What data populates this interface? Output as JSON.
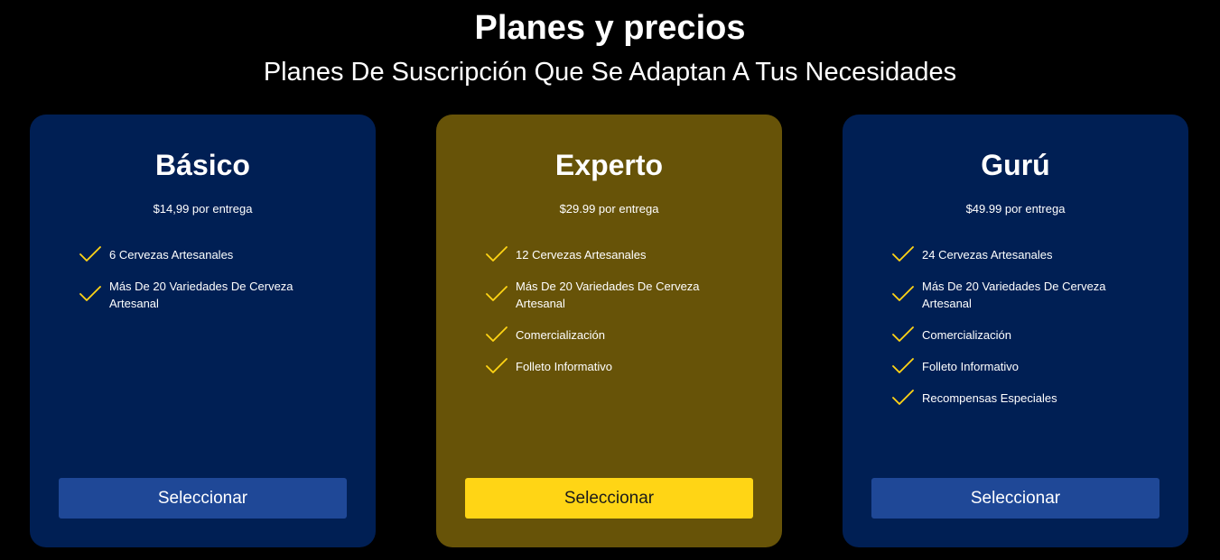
{
  "header": {
    "title": "Planes y precios",
    "subtitle": "Planes De Suscripción Que Se Adaptan A Tus Necesidades"
  },
  "colors": {
    "background": "#000000",
    "card_default": "#001f54",
    "card_featured": "#675308",
    "button_default": "#1f4897",
    "button_featured": "#ffd515",
    "check": "#ffd515"
  },
  "plans": [
    {
      "name": "Básico",
      "price": "$14,99 por entrega",
      "features": [
        "6 Cervezas Artesanales",
        "Más De 20 Variedades De Cerveza Artesanal"
      ],
      "button_label": "Seleccionar",
      "featured": false,
      "icon": "check-icon"
    },
    {
      "name": "Experto",
      "price": "$29.99 por entrega",
      "features": [
        "12 Cervezas Artesanales",
        "Más De 20 Variedades De Cerveza Artesanal",
        "Comercialización",
        "Folleto Informativo"
      ],
      "button_label": "Seleccionar",
      "featured": true,
      "icon": "check-icon"
    },
    {
      "name": "Gurú",
      "price": "$49.99 por entrega",
      "features": [
        "24 Cervezas Artesanales",
        "Más De 20 Variedades De Cerveza Artesanal",
        "Comercialización",
        "Folleto Informativo",
        "Recompensas Especiales"
      ],
      "button_label": "Seleccionar",
      "featured": false,
      "icon": "check-icon"
    }
  ]
}
